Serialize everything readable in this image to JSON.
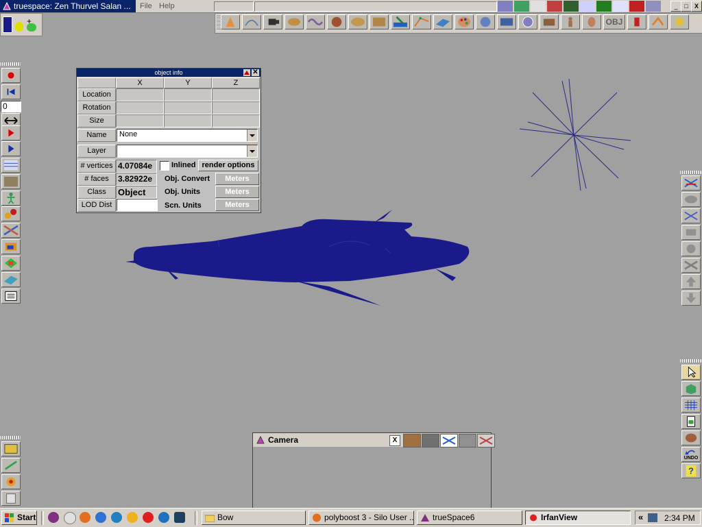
{
  "window": {
    "title": "truespace: Zen Thurvel Salan ...",
    "menu": [
      "File",
      "Help"
    ],
    "controls": [
      "_",
      "□",
      "X"
    ]
  },
  "object_info": {
    "title": "object info",
    "columns": [
      "X",
      "Y",
      "Z"
    ],
    "rows": [
      "Location",
      "Rotation",
      "Size"
    ],
    "name_label": "Name",
    "name_value": "None",
    "layer_label": "Layer",
    "layer_value": "",
    "vertices_label": "# vertices",
    "vertices_value": "4.07084e",
    "faces_label": "# faces",
    "faces_value": "3.82922e",
    "class_label": "Class",
    "class_value": "Object",
    "lod_label": "LOD Dist",
    "lod_value": "",
    "inlined_label": "Inlined",
    "render_options_label": "render options",
    "obj_convert_label": "Obj. Convert",
    "obj_units_label": "Obj. Units",
    "scn_units_label": "Scn. Units",
    "units_value": "Meters"
  },
  "left_toolbar": {
    "frame_value": "0"
  },
  "camera": {
    "title": "Camera",
    "close": "X"
  },
  "taskbar": {
    "start": "Start",
    "tasks": [
      "Bow",
      "polyboost 3 - Silo User ...",
      "trueSpace6",
      "IrfanView"
    ],
    "tray_arrow": "«",
    "clock": "2:34 PM"
  },
  "toolbar_extra": {
    "obj_label": "OBJ",
    "undo_label": "UNDO"
  },
  "colors": {
    "titlebar": "#0a246a",
    "viewport": "#a0a0a0",
    "model": "#1a1a8a",
    "panel": "#c0c0c0"
  }
}
